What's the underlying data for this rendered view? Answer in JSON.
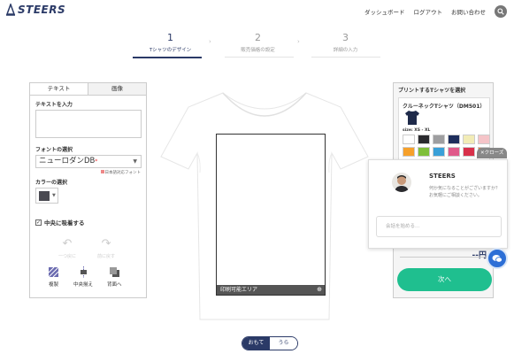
{
  "brand": {
    "logo_text": "STEERS",
    "color": "#2b3a67"
  },
  "topnav": {
    "dashboard": "ダッシュボード",
    "logout": "ログアウト",
    "contact": "お問い合わせ",
    "search_icon": "search-icon"
  },
  "steps": [
    {
      "num": "1",
      "label": "Tシャツのデザイン",
      "active": true
    },
    {
      "num": "2",
      "label": "販売価格の設定",
      "active": false
    },
    {
      "num": "3",
      "label": "詳細の入力",
      "active": false
    }
  ],
  "left_panel": {
    "tab_text": "テキスト",
    "tab_image": "画像",
    "text_input_label": "テキストを入力",
    "font_label": "フォントの選択",
    "font_value": "ニューロダンDB",
    "font_required_mark": "*",
    "japanese_font_note": "日本語対応フォント",
    "color_label": "カラーの選択",
    "selected_color": "#4a4a52",
    "center_align_label": "中央に吸着する",
    "center_align_checked": true,
    "undo_label": "一つ戻に",
    "redo_label": "前に戻す",
    "duplicate_label": "複製",
    "center_label": "中央揃え",
    "back_label": "背面へ"
  },
  "canvas": {
    "print_area_label": "印刷可能エリア",
    "shirt_color": "#ffffff"
  },
  "side_toggle": {
    "front": "おもて",
    "back": "うら",
    "selected": "front"
  },
  "right_panel": {
    "title": "プリントするTシャツを選択",
    "product_name": "クルーネックTシャツ（DM501）",
    "size_label": "size: XS - XL",
    "colors": [
      "#ffffff",
      "#2a2a2e",
      "#9e9ea0",
      "#1e2e5c",
      "#f2ecb6",
      "#f5c4c8",
      "#f6a02a",
      "#7fbf3a",
      "#3aa0d8",
      "#e05a8a",
      "#d8304a",
      "#e8803a"
    ],
    "price": "--円",
    "next_button": "次へ"
  },
  "chat": {
    "close_label": "✕クローズ",
    "name": "STEERS",
    "message": "何か気になることがございますか？お気軽にご相談ください。",
    "input_placeholder": "会話を始める..."
  }
}
